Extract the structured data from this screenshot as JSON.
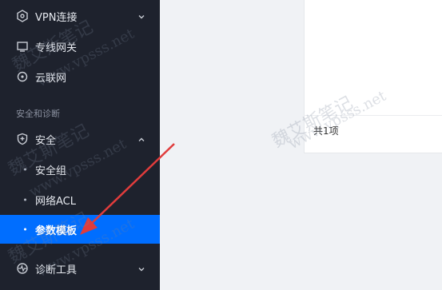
{
  "sidebar": {
    "items": [
      {
        "label": "VPN连接",
        "icon": "vpn-icon"
      },
      {
        "label": "专线网关",
        "icon": "dedicated-line-icon"
      },
      {
        "label": "云联网",
        "icon": "cloud-network-icon"
      }
    ],
    "section_title": "安全和诊断",
    "security": {
      "label": "安全",
      "icon": "shield-icon"
    },
    "security_children": [
      "安全组",
      "网络ACL",
      "参数模板"
    ],
    "diagnosis": {
      "label": "诊断工具",
      "icon": "diagnosis-icon"
    }
  },
  "content": {
    "total_text": "共1项"
  },
  "watermark": {
    "line1": "魏艾斯笔记",
    "line2": "www.vpsss.net"
  },
  "colors": {
    "sidebar_bg": "#1e222d",
    "active_bg": "#006eff",
    "arrow": "#e03c3c"
  }
}
